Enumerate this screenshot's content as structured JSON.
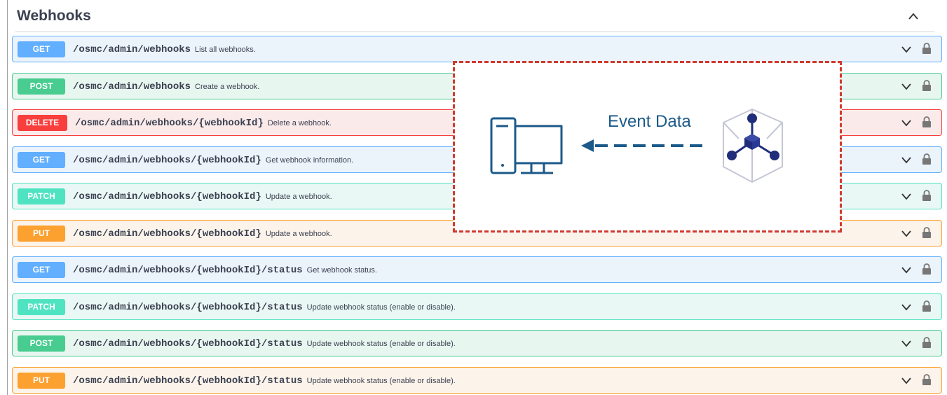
{
  "section": {
    "title": "Webhooks"
  },
  "operations": [
    {
      "method": "GET",
      "path": "/osmc/admin/webhooks",
      "summary": "List all webhooks."
    },
    {
      "method": "POST",
      "path": "/osmc/admin/webhooks",
      "summary": "Create a webhook."
    },
    {
      "method": "DELETE",
      "path": "/osmc/admin/webhooks/{webhookId}",
      "summary": "Delete a webhook."
    },
    {
      "method": "GET",
      "path": "/osmc/admin/webhooks/{webhookId}",
      "summary": "Get webhook information."
    },
    {
      "method": "PATCH",
      "path": "/osmc/admin/webhooks/{webhookId}",
      "summary": "Update a webhook."
    },
    {
      "method": "PUT",
      "path": "/osmc/admin/webhooks/{webhookId}",
      "summary": "Update a webhook."
    },
    {
      "method": "GET",
      "path": "/osmc/admin/webhooks/{webhookId}/status",
      "summary": "Get webhook status."
    },
    {
      "method": "PATCH",
      "path": "/osmc/admin/webhooks/{webhookId}/status",
      "summary": "Update webhook status (enable or disable)."
    },
    {
      "method": "POST",
      "path": "/osmc/admin/webhooks/{webhookId}/status",
      "summary": "Update webhook status (enable or disable)."
    },
    {
      "method": "PUT",
      "path": "/osmc/admin/webhooks/{webhookId}/status",
      "summary": "Update webhook status (enable or disable)."
    }
  ],
  "overlay": {
    "label": "Event Data"
  },
  "icons": {
    "collapse": "chevron-up-icon",
    "expand": "chevron-down-icon",
    "lock": "lock-icon",
    "computer": "computer-icon",
    "hub": "hub-cube-icon"
  },
  "colors": {
    "get": "#61affe",
    "post": "#49cc90",
    "delete": "#f93e3e",
    "patch": "#50e3c2",
    "put": "#fca130",
    "overlay_border": "#d13a2f",
    "diagram_blue": "#1b5a8a",
    "hub_navy": "#1f2d7a"
  }
}
